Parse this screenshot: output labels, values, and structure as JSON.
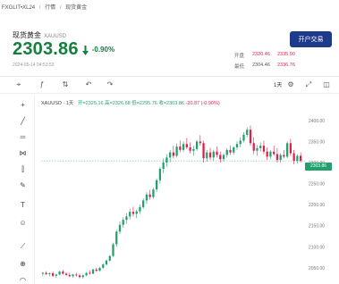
{
  "breadcrumb": [
    "FXGLIT•XL24",
    "/",
    "行情",
    "/",
    "现货黄金"
  ],
  "header": {
    "title": "现货黄金",
    "symbol": "XAUUSD",
    "price": "2303.86",
    "change_pct": "-0.90%",
    "timestamp": "2024-05-14 04:53:53",
    "trade_button": "开户交易"
  },
  "stats": [
    {
      "label": "开盘",
      "v1": "2320.46",
      "v2": "2335.90",
      "style": "red"
    },
    {
      "label": "最低",
      "v1": "2304.46",
      "v2": "2336.76",
      "style": "mixed"
    }
  ],
  "toolbar": {
    "period": "1天",
    "icons": [
      "crosshair-icon",
      "indicator-icon",
      "compare-icon",
      "undo-icon",
      "redo-icon",
      "settings-icon",
      "fullscreen-icon",
      "screenshot-icon"
    ]
  },
  "ohlc": {
    "name": "XAUUSD · 1天",
    "open": "开=2325.16",
    "high": "高=2326.68",
    "low": "低=2295.76",
    "close": "收=2303.86",
    "change": "-20.87 (-0.90%)"
  },
  "sidebar_icons": [
    "cursor-icon",
    "trend-line-icon",
    "horizontal-line-icon",
    "pattern-icon",
    "fib-icon",
    "brush-icon",
    "text-icon",
    "emoji-icon",
    "ruler-icon",
    "zoom-icon",
    "magnet-icon"
  ],
  "chart_data": {
    "type": "candlestick",
    "y_ticks": [
      "2400.00",
      "2350.00",
      "2300.00",
      "2250.00",
      "2200.00",
      "2150.00",
      "2100.00",
      "2050.00"
    ],
    "last_price_tag": "2303.86",
    "ylim": [
      2020,
      2440
    ],
    "up_color": "#22a06b",
    "down_color": "#e11d48",
    "candles": [
      [
        2036,
        2040,
        2030,
        2038
      ],
      [
        2038,
        2042,
        2033,
        2035
      ],
      [
        2035,
        2039,
        2030,
        2037
      ],
      [
        2037,
        2041,
        2028,
        2031
      ],
      [
        2031,
        2036,
        2026,
        2034
      ],
      [
        2034,
        2043,
        2032,
        2041
      ],
      [
        2041,
        2045,
        2034,
        2036
      ],
      [
        2036,
        2039,
        2030,
        2033
      ],
      [
        2033,
        2038,
        2028,
        2030
      ],
      [
        2030,
        2035,
        2026,
        2034
      ],
      [
        2034,
        2038,
        2029,
        2032
      ],
      [
        2032,
        2036,
        2025,
        2028
      ],
      [
        2028,
        2034,
        2024,
        2032
      ],
      [
        2032,
        2040,
        2030,
        2038
      ],
      [
        2038,
        2044,
        2034,
        2036
      ],
      [
        2036,
        2048,
        2035,
        2046
      ],
      [
        2046,
        2050,
        2040,
        2043
      ],
      [
        2043,
        2052,
        2041,
        2050
      ],
      [
        2050,
        2060,
        2048,
        2058
      ],
      [
        2058,
        2070,
        2055,
        2067
      ],
      [
        2067,
        2080,
        2065,
        2078
      ],
      [
        2078,
        2110,
        2076,
        2106
      ],
      [
        2106,
        2140,
        2100,
        2136
      ],
      [
        2136,
        2160,
        2130,
        2152
      ],
      [
        2152,
        2170,
        2145,
        2164
      ],
      [
        2164,
        2180,
        2155,
        2172
      ],
      [
        2172,
        2190,
        2165,
        2183
      ],
      [
        2183,
        2195,
        2172,
        2178
      ],
      [
        2178,
        2188,
        2168,
        2184
      ],
      [
        2184,
        2200,
        2178,
        2194
      ],
      [
        2194,
        2215,
        2190,
        2210
      ],
      [
        2210,
        2230,
        2202,
        2224
      ],
      [
        2224,
        2235,
        2212,
        2218
      ],
      [
        2218,
        2240,
        2214,
        2236
      ],
      [
        2236,
        2262,
        2230,
        2258
      ],
      [
        2258,
        2290,
        2250,
        2285
      ],
      [
        2285,
        2310,
        2275,
        2300
      ],
      [
        2300,
        2320,
        2290,
        2312
      ],
      [
        2312,
        2330,
        2300,
        2324
      ],
      [
        2324,
        2340,
        2310,
        2316
      ],
      [
        2316,
        2345,
        2312,
        2338
      ],
      [
        2338,
        2352,
        2325,
        2330
      ],
      [
        2330,
        2350,
        2326,
        2344
      ],
      [
        2344,
        2358,
        2332,
        2336
      ],
      [
        2336,
        2348,
        2322,
        2328
      ],
      [
        2328,
        2340,
        2316,
        2332
      ],
      [
        2332,
        2354,
        2328,
        2350
      ],
      [
        2350,
        2365,
        2340,
        2346
      ],
      [
        2346,
        2352,
        2300,
        2310
      ],
      [
        2310,
        2330,
        2302,
        2324
      ],
      [
        2324,
        2335,
        2306,
        2312
      ],
      [
        2312,
        2330,
        2304,
        2326
      ],
      [
        2326,
        2338,
        2312,
        2318
      ],
      [
        2318,
        2326,
        2300,
        2308
      ],
      [
        2308,
        2322,
        2302,
        2318
      ],
      [
        2318,
        2334,
        2312,
        2330
      ],
      [
        2330,
        2340,
        2318,
        2324
      ],
      [
        2324,
        2338,
        2318,
        2336
      ],
      [
        2336,
        2350,
        2330,
        2344
      ],
      [
        2344,
        2360,
        2336,
        2352
      ],
      [
        2352,
        2372,
        2348,
        2366
      ],
      [
        2366,
        2384,
        2360,
        2378
      ],
      [
        2378,
        2388,
        2340,
        2346
      ],
      [
        2346,
        2360,
        2320,
        2328
      ],
      [
        2328,
        2342,
        2316,
        2334
      ],
      [
        2334,
        2348,
        2326,
        2340
      ],
      [
        2340,
        2352,
        2320,
        2326
      ],
      [
        2326,
        2336,
        2306,
        2314
      ],
      [
        2314,
        2330,
        2308,
        2326
      ],
      [
        2326,
        2340,
        2316,
        2320
      ],
      [
        2320,
        2334,
        2300,
        2306
      ],
      [
        2306,
        2322,
        2300,
        2318
      ],
      [
        2318,
        2330,
        2310,
        2314
      ],
      [
        2314,
        2350,
        2310,
        2346
      ],
      [
        2346,
        2356,
        2316,
        2322
      ],
      [
        2322,
        2330,
        2296,
        2304
      ],
      [
        2304,
        2320,
        2298,
        2316
      ],
      [
        2316,
        2324,
        2300,
        2304
      ]
    ]
  }
}
